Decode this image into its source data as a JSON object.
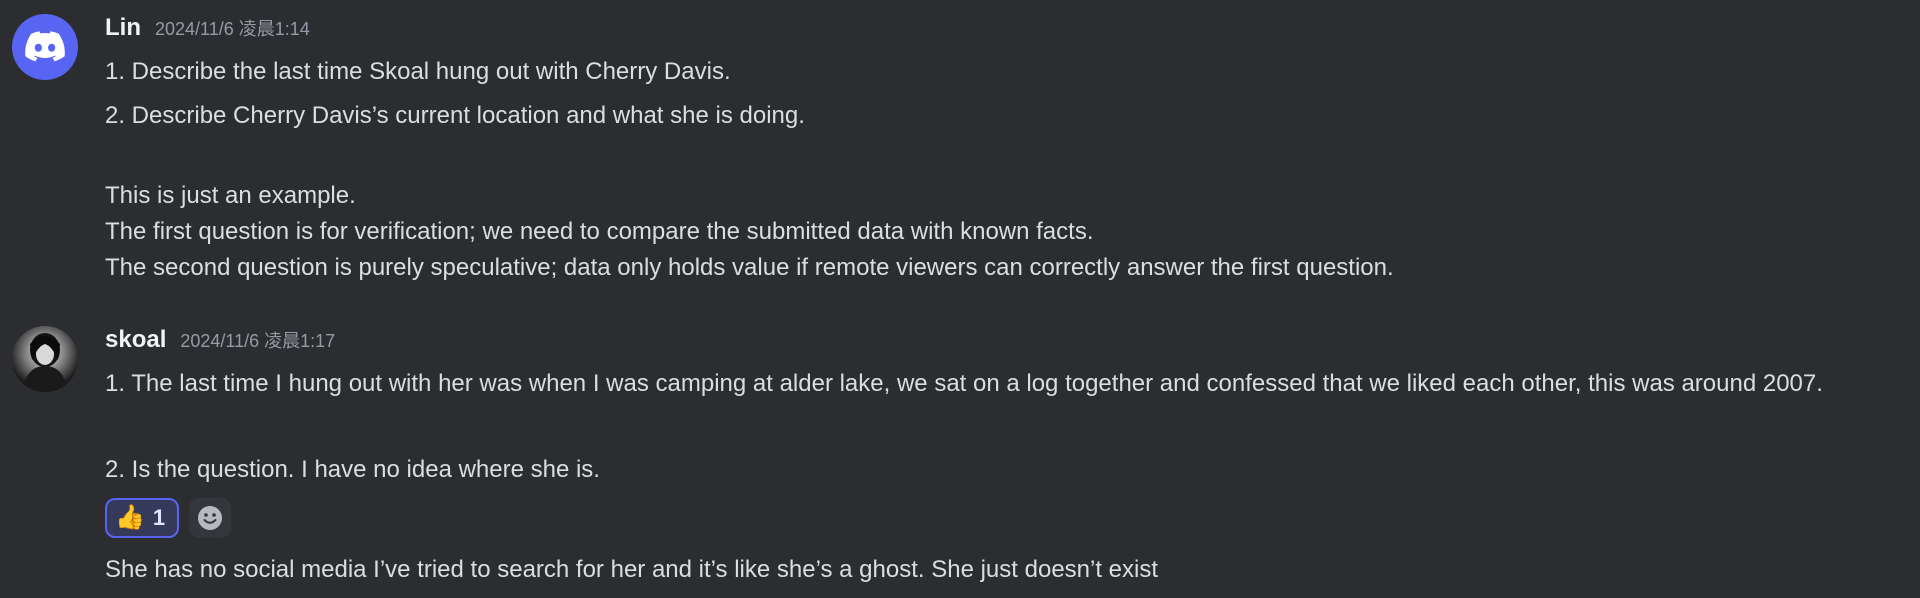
{
  "messages": [
    {
      "username": "Lin",
      "timestamp": "2024/11/6 凌晨1:14",
      "lines": [
        "1. Describe the last time Skoal hung out with Cherry Davis.",
        "2. Describe Cherry Davis’s current location and what she is doing.",
        "This is just an example.",
        "The first question is for verification; we need to compare the submitted data with known facts.",
        "The second question is purely speculative; data only holds value if remote viewers can correctly answer the first question."
      ]
    },
    {
      "username": "skoal",
      "timestamp": "2024/11/6 凌晨1:17",
      "lines": [
        "1. The last time I hung out with her was when I was camping at alder lake, we sat on a log together and confessed that we liked each other, this was around 2007.",
        "2. Is the question. I have no idea where she is."
      ],
      "reaction": {
        "emoji": "👍",
        "count": "1"
      },
      "followup": "She has no social media I’ve tried to search for her and it’s like she’s a ghost. She just doesn’t exist"
    }
  ],
  "colors": {
    "background": "#2c2d31",
    "discord_blurple": "#5865f2",
    "text": "#dbdee1",
    "username": "#f2f3f5",
    "timestamp": "#949ba4"
  },
  "icons": {
    "lin_avatar": "discord-logo-icon",
    "add_reaction": "smiley-icon"
  }
}
